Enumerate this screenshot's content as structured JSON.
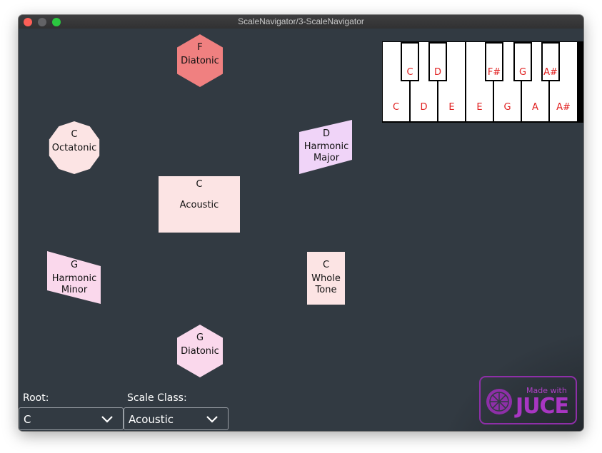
{
  "window": {
    "title": "ScaleNavigator/3-ScaleNavigator"
  },
  "colors": {
    "background": "#323a42",
    "selected_node": "#f08080",
    "node_pink": "#fce4e4",
    "node_lavender": "#f0d4f8",
    "node_rose": "#fad8ec",
    "key_label": "#e02020",
    "juce_purple": "#a836c2"
  },
  "nodes": [
    {
      "root": "F",
      "name_lines": [
        "Diatonic"
      ],
      "shape": "hexagon",
      "state": "selected"
    },
    {
      "root": "C",
      "name_lines": [
        "Octatonic"
      ],
      "shape": "decagon",
      "state": "normal"
    },
    {
      "root": "D",
      "name_lines": [
        "Harmonic",
        "Major"
      ],
      "shape": "parallelogram",
      "state": "normal"
    },
    {
      "root": "C",
      "name_lines": [
        "Acoustic"
      ],
      "shape": "rectangle",
      "state": "normal"
    },
    {
      "root": "G",
      "name_lines": [
        "Harmonic",
        "Minor"
      ],
      "shape": "parallelogram",
      "state": "normal"
    },
    {
      "root": "C",
      "name_lines": [
        "Whole",
        "Tone"
      ],
      "shape": "rectangle",
      "state": "normal"
    },
    {
      "root": "G",
      "name_lines": [
        "Diatonic"
      ],
      "shape": "hexagon",
      "state": "normal"
    }
  ],
  "keyboard": {
    "white_keys": [
      "C",
      "D",
      "E",
      "E",
      "G",
      "A",
      "A#"
    ],
    "black_keys": [
      "C",
      "D",
      "F#",
      "G",
      "A#"
    ]
  },
  "controls": {
    "root_label": "Root:",
    "root_value": "C",
    "scale_class_label": "Scale Class:",
    "scale_class_value": "Acoustic"
  },
  "badge": {
    "line1": "Made with",
    "line2": "JUCE",
    "logo_icon": "juce-lemon-icon"
  }
}
